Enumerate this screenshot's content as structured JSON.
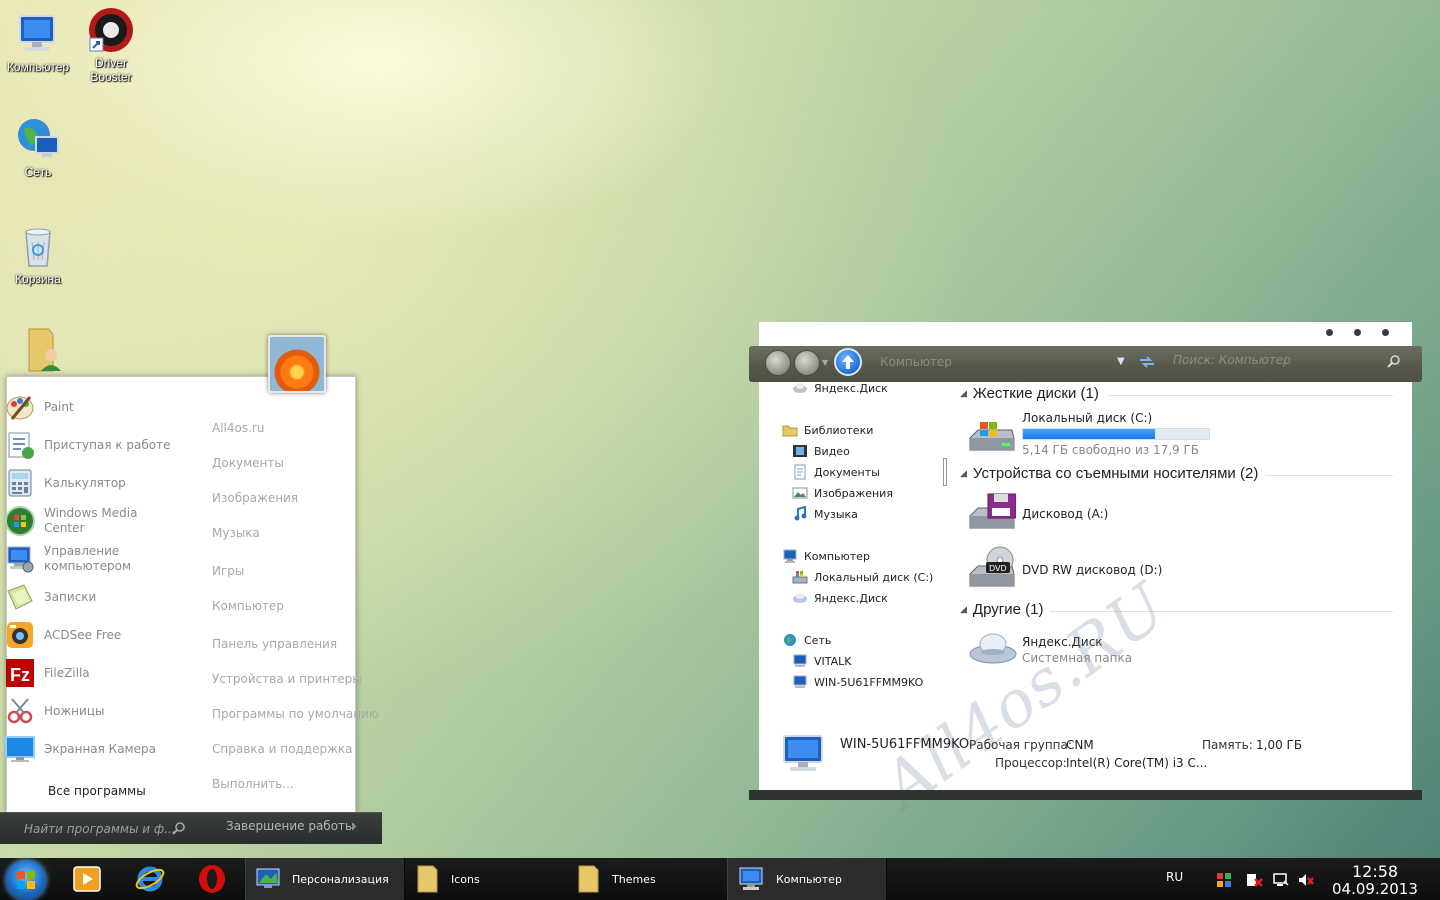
{
  "desktop": {
    "icons": [
      {
        "label": "Компьютер",
        "icon": "computer-icon"
      },
      {
        "label": "Driver Booster",
        "icon": "driver-booster-icon"
      },
      {
        "label": "Сеть",
        "icon": "network-icon"
      },
      {
        "label": "Корзина",
        "icon": "recycle-bin-icon"
      },
      {
        "label": "",
        "icon": "user-folder-icon"
      }
    ]
  },
  "start_menu": {
    "programs": [
      {
        "label": "Paint",
        "icon": "paint-icon"
      },
      {
        "label": "Приступая к работе",
        "icon": "getting-started-icon"
      },
      {
        "label": "Калькулятор",
        "icon": "calculator-icon"
      },
      {
        "label": "Windows Media\nCenter",
        "icon": "media-center-icon"
      },
      {
        "label": "Управление\nкомпьютером",
        "icon": "computer-management-icon"
      },
      {
        "label": "Записки",
        "icon": "sticky-notes-icon"
      },
      {
        "label": "ACDSee Free",
        "icon": "acdsee-icon"
      },
      {
        "label": "FileZilla",
        "icon": "filezilla-icon"
      },
      {
        "label": "Ножницы",
        "icon": "snipping-tool-icon"
      },
      {
        "label": "Экранная Камера",
        "icon": "screen-camera-icon"
      }
    ],
    "all_programs": "Все программы",
    "right_links": [
      "All4os.ru",
      "Документы",
      "Изображения",
      "Музыка",
      "Игры",
      "Компьютер",
      "Панель управления",
      "Устройства и принтеры",
      "Программы по умолчанию",
      "Справка и поддержка",
      "Выполнить..."
    ],
    "search_placeholder": "Найти программы и ф...",
    "shutdown_label": "Завершение работы",
    "shutdown_arrow": "›"
  },
  "explorer": {
    "address": "Компьютер",
    "search_placeholder": "Поиск: Компьютер",
    "nav_pane": [
      {
        "label": "Яндекс.Диск",
        "icon": "yandex-disk-icon",
        "indent": 1
      },
      {
        "label": "Библиотеки",
        "icon": "libraries-icon",
        "indent": 0
      },
      {
        "label": "Видео",
        "icon": "video-library-icon",
        "indent": 1
      },
      {
        "label": "Документы",
        "icon": "documents-library-icon",
        "indent": 1
      },
      {
        "label": "Изображения",
        "icon": "pictures-library-icon",
        "indent": 1
      },
      {
        "label": "Музыка",
        "icon": "music-library-icon",
        "indent": 1
      },
      {
        "label": "Компьютер",
        "icon": "computer-icon",
        "indent": 0
      },
      {
        "label": "Локальный диск (C:)",
        "icon": "local-disk-icon",
        "indent": 1
      },
      {
        "label": "Яндекс.Диск",
        "icon": "yandex-disk-icon",
        "indent": 1
      },
      {
        "label": "Сеть",
        "icon": "network-icon",
        "indent": 0
      },
      {
        "label": "VITALK",
        "icon": "network-computer-icon",
        "indent": 1
      },
      {
        "label": "WIN-5U61FFMM9KO",
        "icon": "network-computer-icon",
        "indent": 1
      }
    ],
    "groups": [
      {
        "title": "Жесткие диски (1)"
      },
      {
        "title": "Устройства со съемными носителями (2)"
      },
      {
        "title": "Другие (1)"
      }
    ],
    "drives": {
      "c_name": "Локальный диск (C:)",
      "c_free": "5,14 ГБ свободно из 17,9 ГБ",
      "c_used_fraction": 0.71,
      "a_name": "Дисковод (A:)",
      "d_name": "DVD RW дисковод (D:)",
      "d_badge": "DVD",
      "y_name": "Яндекс.Диск",
      "y_sub": "Системная папка"
    },
    "details": {
      "computer_name": "WIN-5U61FFMM9KO",
      "workgroup_key": "Рабочая группа:",
      "workgroup_val": "CNM",
      "memory_key": "Память:",
      "memory_val": "1,00 ГБ",
      "cpu_key": "Процессор:",
      "cpu_val": "Intel(R) Core(TM) i3 C..."
    },
    "watermark": "All4os.RU"
  },
  "taskbar": {
    "pinned": [
      {
        "icon": "media-player-icon"
      },
      {
        "icon": "internet-explorer-icon"
      },
      {
        "icon": "opera-icon"
      }
    ],
    "tasks": [
      {
        "label": "Персонализация",
        "icon": "personalization-icon"
      },
      {
        "label": "Icons",
        "icon": "folder-icon"
      },
      {
        "label": "Themes",
        "icon": "folder-icon"
      },
      {
        "label": "Компьютер",
        "icon": "computer-icon"
      }
    ],
    "lang": "RU",
    "time": "12:58",
    "date": "04.09.2013"
  }
}
